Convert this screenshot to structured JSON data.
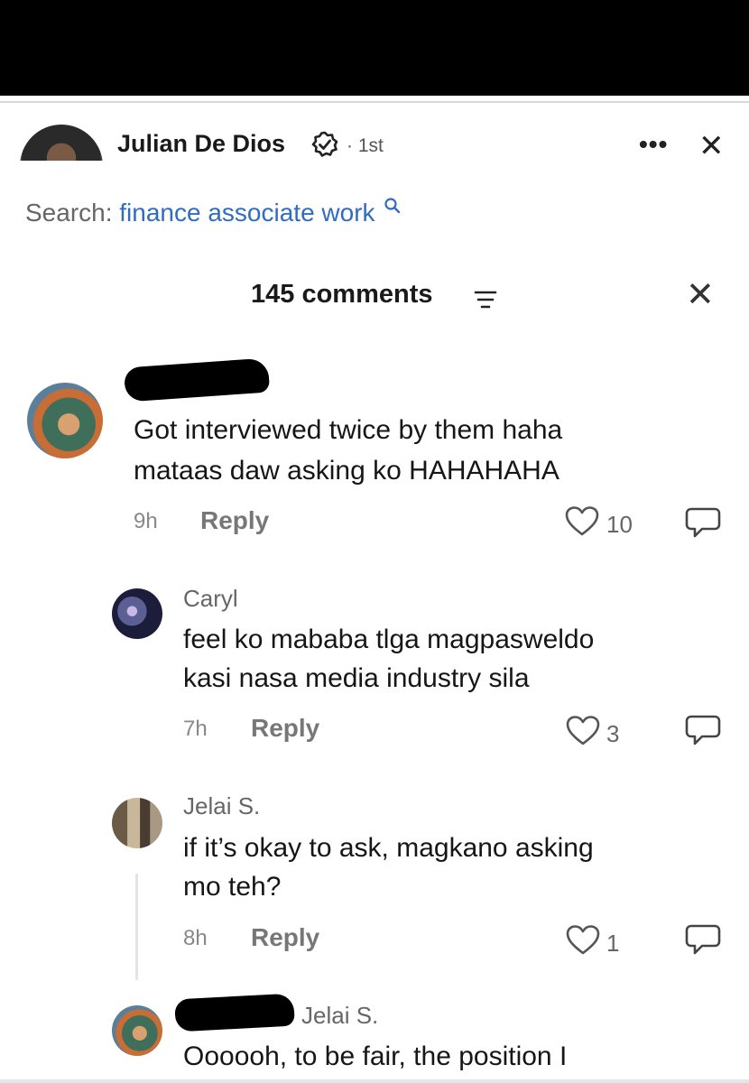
{
  "post": {
    "author": "Julian De Dios",
    "degree": "· 1st"
  },
  "search": {
    "label": "Search:",
    "term": "finance associate work"
  },
  "comments_header": {
    "title": "145 comments"
  },
  "comments": [
    {
      "author": "",
      "lines": [
        "Got interviewed twice by them haha",
        "mataas daw asking ko HAHAHAHA"
      ],
      "time": "9h",
      "reply_label": "Reply",
      "likes": "10"
    },
    {
      "author": "Caryl",
      "lines": [
        "feel ko mababa tlga magpasweldo",
        "kasi nasa media industry sila"
      ],
      "time": "7h",
      "reply_label": "Reply",
      "likes": "3"
    },
    {
      "author": "Jelai S.",
      "lines": [
        "if it’s okay to ask, magkano asking",
        "mo teh?"
      ],
      "time": "8h",
      "reply_label": "Reply",
      "likes": "1"
    },
    {
      "author": "Jelai S.",
      "lines": [
        "Oooooh, to be fair, the position I"
      ]
    }
  ],
  "colors": {
    "link": "#2f6cc4",
    "text": "#161616",
    "muted": "#666666"
  }
}
